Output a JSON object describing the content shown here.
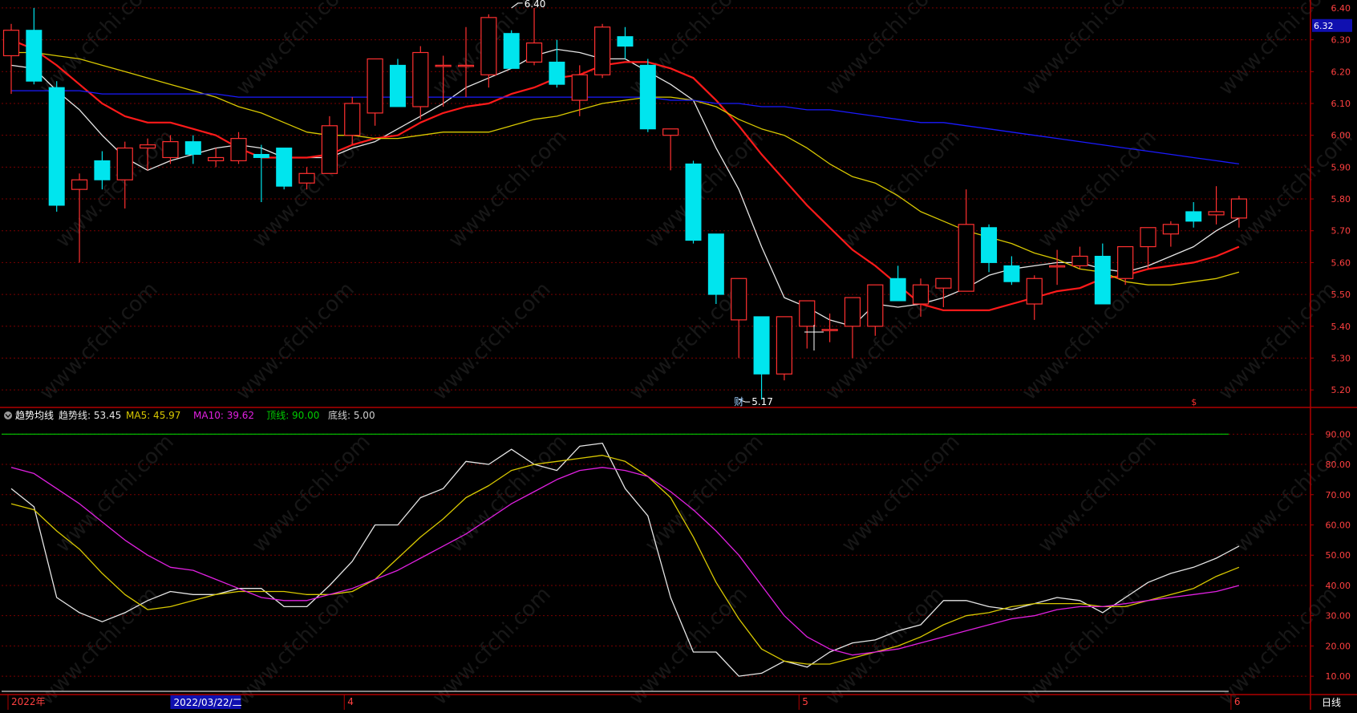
{
  "colors": {
    "background": "#000000",
    "grid": "#7a0000",
    "frame": "#b00000",
    "up": "#ff3030",
    "down": "#00e5ee",
    "ma5": "#e6e6e6",
    "ma10": "#ff1a1a",
    "ma20": "#d8c800",
    "ma60": "#1a1aff",
    "trend": "#e6e6e6",
    "trend_ma5": "#d8c800",
    "trend_ma10": "#e020e0",
    "top_line": "#00cc00",
    "bottom_line": "#d0d0d0",
    "axis_text": "#ff4040",
    "price_box": "#1010b0",
    "highlight_box": "#1010b0"
  },
  "chart_data": [
    {
      "type": "candlestick",
      "series_name": "price",
      "ylim": [
        5.15,
        6.42
      ],
      "y_ticks": [
        5.2,
        5.3,
        5.4,
        5.5,
        5.6,
        5.7,
        5.8,
        5.9,
        6.0,
        6.1,
        6.2,
        6.3,
        6.4
      ],
      "y_tick_labels": [
        "5.20",
        "5.30",
        "5.40",
        "5.50",
        "5.60",
        "5.70",
        "5.80",
        "5.90",
        "6.00",
        "6.10",
        "6.20",
        "6.30",
        "6.40"
      ],
      "current_price_label": "6.32",
      "high_annotation": {
        "label": "6.40",
        "index": 22,
        "value": 6.4
      },
      "low_annotation": {
        "label": "5.17",
        "index": 32,
        "value": 5.17
      },
      "event_markers": [
        {
          "label": "财",
          "index": 32
        },
        {
          "label": "$",
          "index": 52
        }
      ],
      "ohlc": [
        [
          6.25,
          6.35,
          6.13,
          6.33
        ],
        [
          6.33,
          6.4,
          6.16,
          6.17
        ],
        [
          6.15,
          6.17,
          5.76,
          5.78
        ],
        [
          5.83,
          5.88,
          5.6,
          5.86
        ],
        [
          5.92,
          5.95,
          5.83,
          5.86
        ],
        [
          5.86,
          5.98,
          5.77,
          5.96
        ],
        [
          5.96,
          5.99,
          5.89,
          5.97
        ],
        [
          5.93,
          6.0,
          5.91,
          5.98
        ],
        [
          5.98,
          6.0,
          5.91,
          5.94
        ],
        [
          5.92,
          5.96,
          5.9,
          5.93
        ],
        [
          5.92,
          6.01,
          5.91,
          5.99
        ],
        [
          5.94,
          5.97,
          5.79,
          5.93
        ],
        [
          5.96,
          5.96,
          5.83,
          5.84
        ],
        [
          5.85,
          5.9,
          5.83,
          5.88
        ],
        [
          5.88,
          6.06,
          5.88,
          6.03
        ],
        [
          6.0,
          6.12,
          5.97,
          6.1
        ],
        [
          6.07,
          6.24,
          6.03,
          6.24
        ],
        [
          6.22,
          6.24,
          6.09,
          6.09
        ],
        [
          6.09,
          6.28,
          6.05,
          6.26
        ],
        [
          6.22,
          6.25,
          6.09,
          6.22
        ],
        [
          6.22,
          6.34,
          6.12,
          6.22
        ],
        [
          6.19,
          6.38,
          6.15,
          6.37
        ],
        [
          6.32,
          6.33,
          6.22,
          6.21
        ],
        [
          6.23,
          6.4,
          6.22,
          6.29
        ],
        [
          6.23,
          6.3,
          6.15,
          6.16
        ],
        [
          6.11,
          6.22,
          6.06,
          6.19
        ],
        [
          6.19,
          6.35,
          6.18,
          6.34
        ],
        [
          6.31,
          6.34,
          6.24,
          6.28
        ],
        [
          6.22,
          6.24,
          6.01,
          6.02
        ],
        [
          6.0,
          6.02,
          5.89,
          6.02
        ],
        [
          5.91,
          5.92,
          5.66,
          5.67
        ],
        [
          5.69,
          5.69,
          5.47,
          5.5
        ],
        [
          5.42,
          5.55,
          5.3,
          5.55
        ],
        [
          5.43,
          5.43,
          5.17,
          5.25
        ],
        [
          5.25,
          5.42,
          5.23,
          5.43
        ],
        [
          5.4,
          5.48,
          5.33,
          5.48
        ],
        [
          5.39,
          5.44,
          5.35,
          5.39
        ],
        [
          5.4,
          5.49,
          5.3,
          5.49
        ],
        [
          5.4,
          5.53,
          5.37,
          5.53
        ],
        [
          5.55,
          5.59,
          5.48,
          5.48
        ],
        [
          5.47,
          5.55,
          5.43,
          5.53
        ],
        [
          5.52,
          5.54,
          5.46,
          5.55
        ],
        [
          5.51,
          5.83,
          5.51,
          5.72
        ],
        [
          5.71,
          5.72,
          5.57,
          5.6
        ],
        [
          5.59,
          5.62,
          5.53,
          5.54
        ],
        [
          5.47,
          5.56,
          5.42,
          5.55
        ],
        [
          5.59,
          5.64,
          5.53,
          5.59
        ],
        [
          5.59,
          5.65,
          5.58,
          5.62
        ],
        [
          5.62,
          5.66,
          5.47,
          5.47
        ],
        [
          5.55,
          5.65,
          5.53,
          5.65
        ],
        [
          5.65,
          5.71,
          5.58,
          5.71
        ],
        [
          5.69,
          5.73,
          5.65,
          5.72
        ],
        [
          5.76,
          5.79,
          5.71,
          5.73
        ],
        [
          5.75,
          5.84,
          5.72,
          5.76
        ],
        [
          5.74,
          5.81,
          5.71,
          5.8
        ]
      ],
      "ma_lines": [
        {
          "key": "ma5",
          "values": [
            6.22,
            6.21,
            6.14,
            6.08,
            6.0,
            5.93,
            5.89,
            5.92,
            5.94,
            5.96,
            5.97,
            5.96,
            5.93,
            5.93,
            5.93,
            5.96,
            5.98,
            6.02,
            6.06,
            6.1,
            6.15,
            6.18,
            6.21,
            6.25,
            6.27,
            6.26,
            6.24,
            6.24,
            6.2,
            6.16,
            6.11,
            5.96,
            5.83,
            5.65,
            5.49,
            5.46,
            5.42,
            5.4,
            5.47,
            5.46,
            5.47,
            5.49,
            5.52,
            5.56,
            5.58,
            5.59,
            5.6,
            5.6,
            5.58,
            5.57,
            5.59,
            5.62,
            5.65,
            5.7,
            5.74
          ]
        },
        {
          "key": "ma10",
          "values": [
            6.3,
            6.27,
            6.22,
            6.16,
            6.1,
            6.06,
            6.04,
            6.04,
            6.02,
            6.0,
            5.96,
            5.93,
            5.93,
            5.93,
            5.94,
            5.97,
            5.99,
            6.0,
            6.04,
            6.07,
            6.09,
            6.1,
            6.13,
            6.15,
            6.18,
            6.19,
            6.22,
            6.23,
            6.23,
            6.21,
            6.18,
            6.11,
            6.03,
            5.94,
            5.86,
            5.78,
            5.71,
            5.64,
            5.59,
            5.53,
            5.47,
            5.45,
            5.45,
            5.45,
            5.47,
            5.49,
            5.51,
            5.52,
            5.55,
            5.56,
            5.58,
            5.59,
            5.6,
            5.62,
            5.65
          ]
        },
        {
          "key": "ma20",
          "values": [
            6.26,
            6.26,
            6.25,
            6.24,
            6.22,
            6.2,
            6.18,
            6.16,
            6.14,
            6.12,
            6.09,
            6.07,
            6.04,
            6.01,
            6.0,
            6.0,
            5.99,
            5.99,
            6.0,
            6.01,
            6.01,
            6.01,
            6.03,
            6.05,
            6.06,
            6.08,
            6.1,
            6.11,
            6.12,
            6.12,
            6.11,
            6.09,
            6.05,
            6.02,
            6.0,
            5.96,
            5.91,
            5.87,
            5.85,
            5.81,
            5.76,
            5.73,
            5.7,
            5.68,
            5.66,
            5.63,
            5.61,
            5.58,
            5.57,
            5.54,
            5.53,
            5.53,
            5.54,
            5.55,
            5.57
          ]
        },
        {
          "key": "ma60",
          "values": [
            6.14,
            6.14,
            6.14,
            6.14,
            6.13,
            6.13,
            6.13,
            6.13,
            6.13,
            6.13,
            6.12,
            6.12,
            6.12,
            6.12,
            6.12,
            6.12,
            6.12,
            6.12,
            6.12,
            6.12,
            6.12,
            6.12,
            6.12,
            6.12,
            6.12,
            6.12,
            6.12,
            6.12,
            6.12,
            6.11,
            6.11,
            6.1,
            6.1,
            6.09,
            6.09,
            6.08,
            6.08,
            6.07,
            6.06,
            6.05,
            6.04,
            6.04,
            6.03,
            6.02,
            6.01,
            6.0,
            5.99,
            5.98,
            5.97,
            5.96,
            5.95,
            5.94,
            5.93,
            5.92,
            5.91
          ]
        }
      ]
    },
    {
      "type": "line",
      "panel_title": "趋势均线",
      "legend": [
        {
          "label": "趋势线: 53.45",
          "color_key": "trend"
        },
        {
          "label": "MA5: 45.97",
          "color_key": "trend_ma5"
        },
        {
          "label": "MA10: 39.62",
          "color_key": "trend_ma10"
        },
        {
          "label": "顶线: 90.00",
          "color_key": "top_line"
        },
        {
          "label": "底线: 5.00",
          "color_key": "bottom_line"
        }
      ],
      "ylim": [
        5,
        93
      ],
      "y_ticks": [
        10,
        20,
        30,
        40,
        50,
        60,
        70,
        80,
        90
      ],
      "y_tick_labels": [
        "10.00",
        "20.00",
        "30.00",
        "40.00",
        "50.00",
        "60.00",
        "70.00",
        "80.00",
        "90.00"
      ],
      "top_line": 90,
      "bottom_line": 5,
      "series": [
        {
          "name": "趋势线",
          "key": "trend",
          "values": [
            72,
            66,
            36,
            31,
            28,
            31,
            35,
            38,
            37,
            37,
            39,
            39,
            33,
            33,
            40,
            48,
            60,
            60,
            69,
            72,
            81,
            80,
            85,
            80,
            78,
            86,
            87,
            72,
            63,
            36,
            18,
            18,
            10,
            11,
            15,
            13,
            18,
            21,
            22,
            25,
            27,
            35,
            35,
            33,
            32,
            34,
            36,
            35,
            31,
            36,
            41,
            44,
            46,
            49,
            53
          ]
        },
        {
          "name": "MA5",
          "key": "trend_ma5",
          "values": [
            67,
            65,
            58,
            52,
            44,
            37,
            32,
            33,
            35,
            37,
            38,
            38,
            38,
            37,
            37,
            38,
            42,
            49,
            56,
            62,
            69,
            73,
            78,
            80,
            81,
            82,
            83,
            81,
            76,
            69,
            56,
            41,
            29,
            19,
            15,
            14,
            14,
            16,
            18,
            20,
            23,
            27,
            30,
            31,
            33,
            34,
            34,
            34,
            33,
            33,
            35,
            37,
            39,
            43,
            46
          ]
        },
        {
          "name": "MA10",
          "key": "trend_ma10",
          "values": [
            79,
            77,
            72,
            67,
            61,
            55,
            50,
            46,
            45,
            42,
            39,
            36,
            35,
            35,
            37,
            39,
            42,
            45,
            49,
            53,
            57,
            62,
            67,
            71,
            75,
            78,
            79,
            78,
            76,
            71,
            65,
            58,
            50,
            40,
            30,
            23,
            19,
            17,
            18,
            19,
            21,
            23,
            25,
            27,
            29,
            30,
            32,
            33,
            33,
            34,
            35,
            36,
            37,
            38,
            40
          ]
        }
      ]
    }
  ],
  "x_axis": {
    "labels": [
      {
        "text": "2022年",
        "index": 0
      },
      {
        "text": "4",
        "index": 15
      },
      {
        "text": "5",
        "index": 35
      },
      {
        "text": "6",
        "index": 54
      }
    ],
    "highlight_label": {
      "text": "2022/03/22/二",
      "index": 7
    },
    "period_label": "日线"
  },
  "watermark": "www.cfchi.com"
}
